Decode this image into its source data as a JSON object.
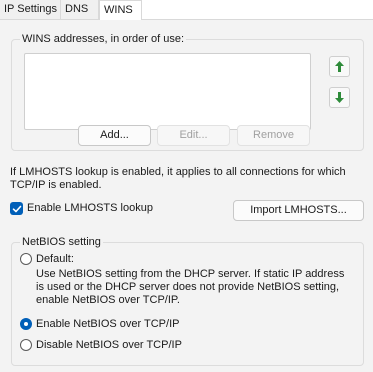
{
  "tabs": [
    {
      "label": "IP Settings"
    },
    {
      "label": "DNS"
    },
    {
      "label": "WINS",
      "active": true
    }
  ],
  "wins": {
    "group_label": "WINS addresses, in order of use:",
    "add_label": "Add...",
    "edit_label": "Edit...",
    "remove_label": "Remove"
  },
  "lmhosts": {
    "info_line1": "If LMHOSTS lookup is enabled, it applies to all connections for which",
    "info_line2": "TCP/IP is enabled.",
    "checkbox_label": "Enable LMHOSTS lookup",
    "checked": true,
    "import_label": "Import LMHOSTS..."
  },
  "netbios": {
    "group_label": "NetBIOS setting",
    "default_label": "Default:",
    "default_desc_1": "Use NetBIOS setting from the DHCP server. If static IP address",
    "default_desc_2": "is used or the DHCP server does not provide NetBIOS setting,",
    "default_desc_3": "enable NetBIOS over TCP/IP.",
    "enable_label": "Enable NetBIOS over TCP/IP",
    "disable_label": "Disable NetBIOS over TCP/IP",
    "selected": "enable"
  },
  "colors": {
    "accent": "#005fb8",
    "arrow_green": "#2e8b3a"
  }
}
